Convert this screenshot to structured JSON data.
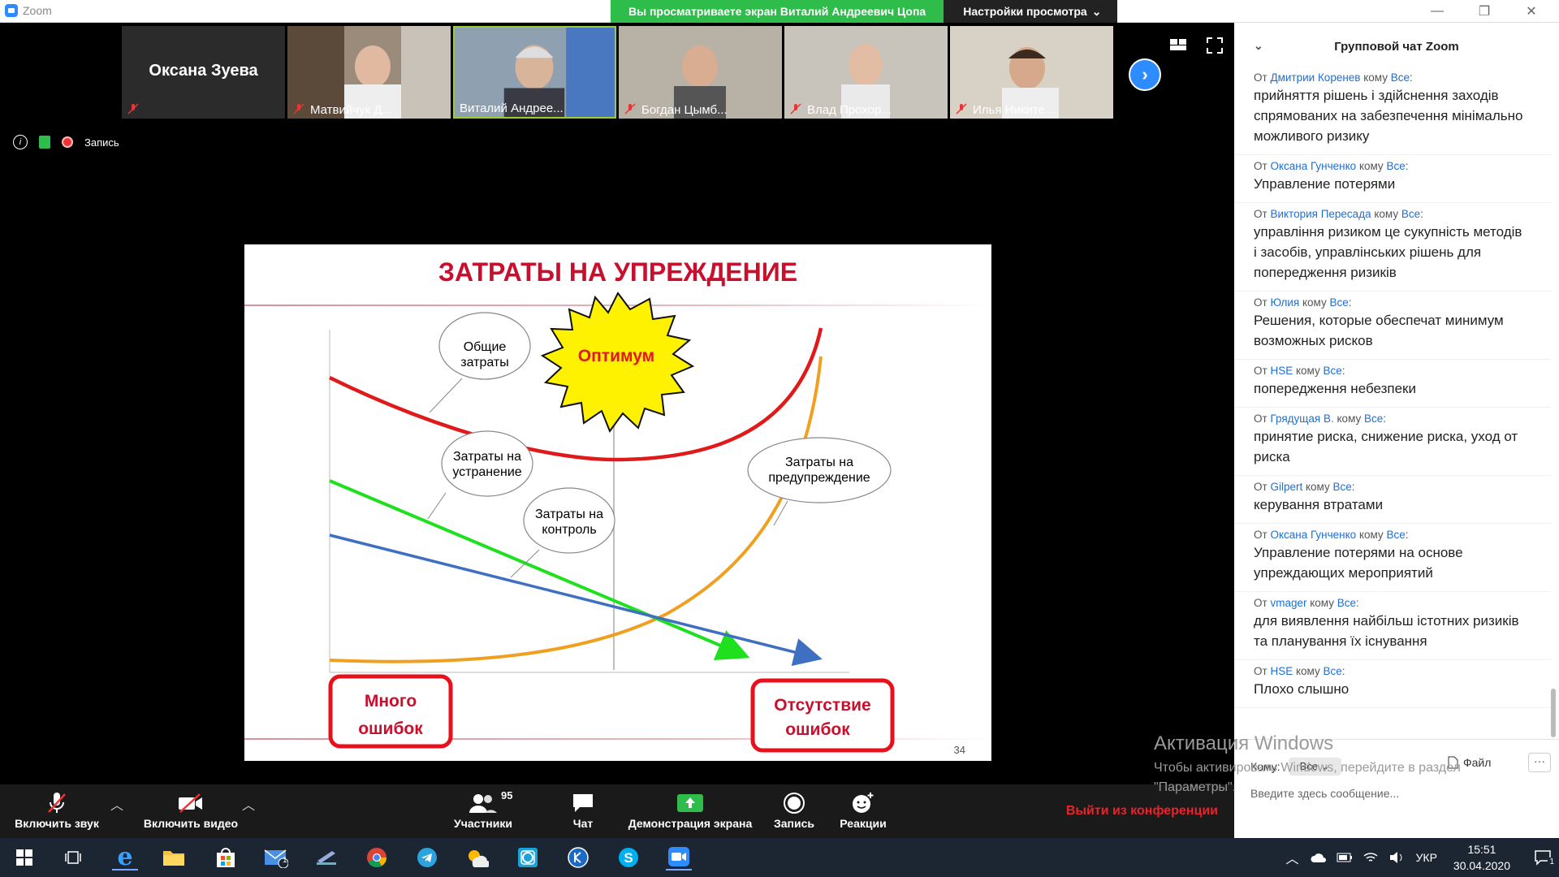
{
  "window": {
    "app_name": "Zoom",
    "minimize": "—",
    "restore": "❐",
    "close": "✕"
  },
  "share_banner": {
    "viewing_text": "Вы просматриваете экран Виталий Андреевич Цопа",
    "view_options": "Настройки просмотра"
  },
  "participants_strip": [
    {
      "name": "Оксана Зуева",
      "type": "name-only"
    },
    {
      "name": "Матвийчук Д...",
      "type": "video"
    },
    {
      "name": "Виталий Андрее...",
      "type": "video",
      "active": true
    },
    {
      "name": "Богдан Цымб...",
      "type": "video"
    },
    {
      "name": "Влад Прохор...",
      "type": "video"
    },
    {
      "name": "Илья Никите...",
      "type": "video"
    }
  ],
  "status": {
    "record_label": "Запись"
  },
  "slide": {
    "title": "ЗАТРАТЫ НА УПРЕЖДЕНИЕ",
    "optimum": "Оптимум",
    "label_total": [
      "Общие",
      "затраты"
    ],
    "label_fix": [
      "Затраты на",
      "устранение"
    ],
    "label_control": [
      "Затраты на",
      "контроль"
    ],
    "label_prevent": [
      "Затраты на",
      "предупреждение"
    ],
    "many_errors": [
      "Много",
      "ошибок"
    ],
    "no_errors": [
      "Отсутствие",
      "ошибок"
    ],
    "page_number": "34"
  },
  "toolbar": {
    "unmute": "Включить звук",
    "start_video": "Включить видео",
    "participants": "Участники",
    "participants_count": "95",
    "chat": "Чат",
    "share_screen": "Демонстрация экрана",
    "record": "Запись",
    "reactions": "Реакции",
    "leave": "Выйти из конференции"
  },
  "chat": {
    "title": "Групповой чат Zoom",
    "messages": [
      {
        "from": "Дмитрии Коренев",
        "to": "Все",
        "text": "прийняття рішень і здійснення заходів спрямованих на забезпечення мінімально можливого ризику"
      },
      {
        "from": "Оксана Гунченко",
        "to": "Все",
        "text": "Управление потерями"
      },
      {
        "from": "Виктория Пересада",
        "to": "Все",
        "text": "управління ризиком це сукупність методів і засобів, управлінських рішень для попередження ризиків"
      },
      {
        "from": "Юлия",
        "to": "Все",
        "text": "Решения, которые обеспечат минимум возможных рисков"
      },
      {
        "from": "HSE",
        "to": "Все",
        "text": "попередження небезпеки"
      },
      {
        "from": "Грядущая В.",
        "to": "Все",
        "text": "принятие риска, снижение риска, уход от риска"
      },
      {
        "from": "Gilpert",
        "to": "Все",
        "text": "керування втратами"
      },
      {
        "from": "Оксана Гунченко",
        "to": "Все",
        "text": "Управление потерями на основе упреждающих мероприятий"
      },
      {
        "from": "vmager",
        "to": "Все",
        "text": "для виявлення  найбільш істотних ризиків  та планування їх існування"
      },
      {
        "from": "HSE",
        "to": "Все",
        "text": "Плохо слышно"
      }
    ],
    "from_word": "От",
    "to_word": "кому",
    "to_label": "Кому:",
    "to_value": "Все",
    "file_label": "Файл",
    "more": "···",
    "input_placeholder": "Введите здесь сообщение..."
  },
  "watermark": {
    "line1": "Активация Windows",
    "line2": "Чтобы активировать Windows, перейдите в раздел",
    "line3": "\"Параметры\"."
  },
  "taskbar": {
    "lang": "УКР",
    "time": "15:51",
    "date": "30.04.2020",
    "notif_count": "1",
    "mail_badge": "1"
  }
}
